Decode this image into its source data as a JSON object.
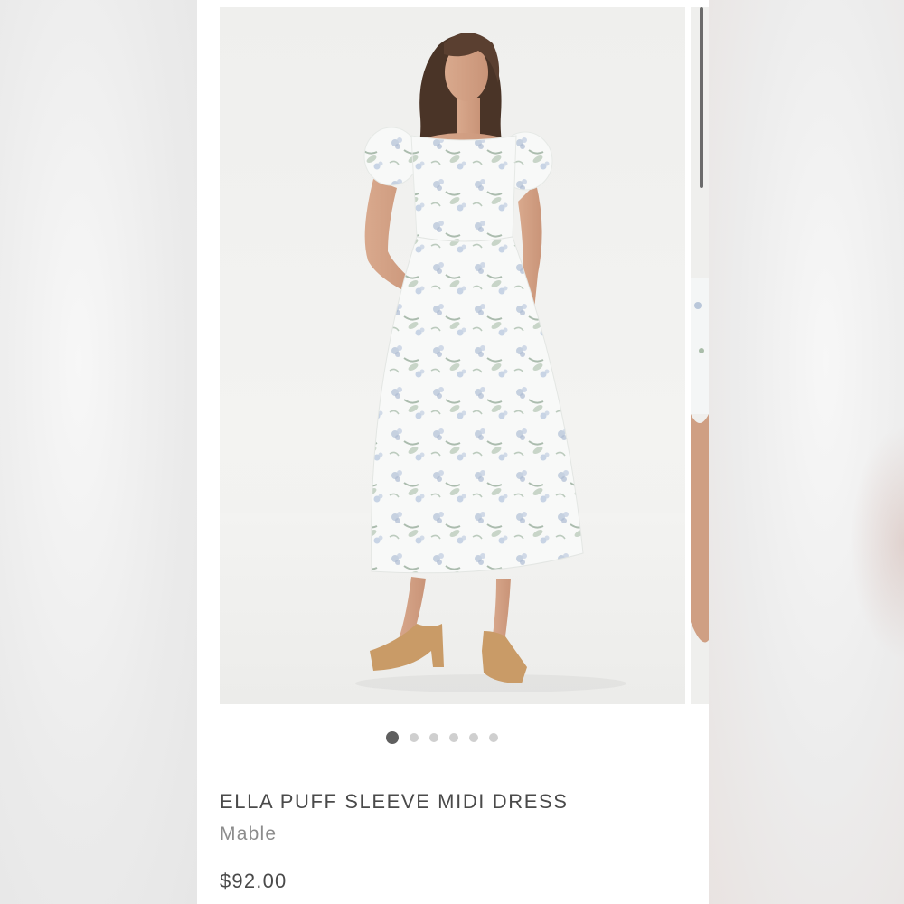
{
  "product": {
    "title": "ELLA PUFF SLEEVE MIDI DRESS",
    "brand": "Mable",
    "price": "$92.00"
  },
  "gallery": {
    "image_count": 6,
    "active_index": 0,
    "image_subject": "model-in-floral-puff-sleeve-midi-dress-icon"
  },
  "colors": {
    "active_dot": "#5f5f5f",
    "inactive_dot": "#cfcfcf",
    "dress_print": "#9fb6c9",
    "leaf": "#8fa893"
  }
}
